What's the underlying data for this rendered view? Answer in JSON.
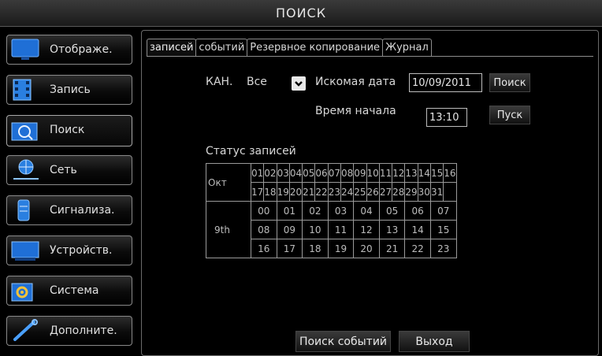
{
  "title": "ПОИСК",
  "sidebar": {
    "items": [
      {
        "label": "Отображе."
      },
      {
        "label": "Запись"
      },
      {
        "label": "Поиск"
      },
      {
        "label": "Сеть"
      },
      {
        "label": "Сигнализа."
      },
      {
        "label": "Устройств."
      },
      {
        "label": "Система"
      },
      {
        "label": "Дополните."
      }
    ],
    "active_index": 2
  },
  "tabs": [
    {
      "label": "записей",
      "active": true
    },
    {
      "label": "событий",
      "active": false
    },
    {
      "label": "Резервное копирование",
      "active": false
    },
    {
      "label": "Журнал",
      "active": false
    }
  ],
  "form": {
    "channel_label": "КАН.",
    "channel_value": "Все",
    "search_date_label": "Искомая дата",
    "search_date_value": "10/09/2011",
    "search_button": "Поиск",
    "start_time_label": "Время начала",
    "start_time_value": "13:10",
    "play_button": "Пуск"
  },
  "status": {
    "title": "Статус записей",
    "month_label": "Окт",
    "days_row1": [
      "01",
      "02",
      "03",
      "04",
      "05",
      "06",
      "07",
      "08",
      "09",
      "10",
      "11",
      "12",
      "13",
      "14",
      "15",
      "16"
    ],
    "days_row2": [
      "17",
      "18",
      "19",
      "20",
      "21",
      "22",
      "23",
      "24",
      "25",
      "26",
      "27",
      "28",
      "29",
      "30",
      "31",
      ""
    ],
    "day_label": "9th",
    "hours": [
      [
        "00",
        "01",
        "02",
        "03",
        "04",
        "05",
        "06",
        "07"
      ],
      [
        "08",
        "09",
        "10",
        "11",
        "12",
        "13",
        "14",
        "15"
      ],
      [
        "16",
        "17",
        "18",
        "19",
        "20",
        "21",
        "22",
        "23"
      ]
    ]
  },
  "footer": {
    "event_search_button": "Поиск событий",
    "exit_button": "Выход"
  },
  "colors": {
    "background": "#000000",
    "border": "#8c8c8c",
    "icon_blue": "#1f6fd6"
  }
}
